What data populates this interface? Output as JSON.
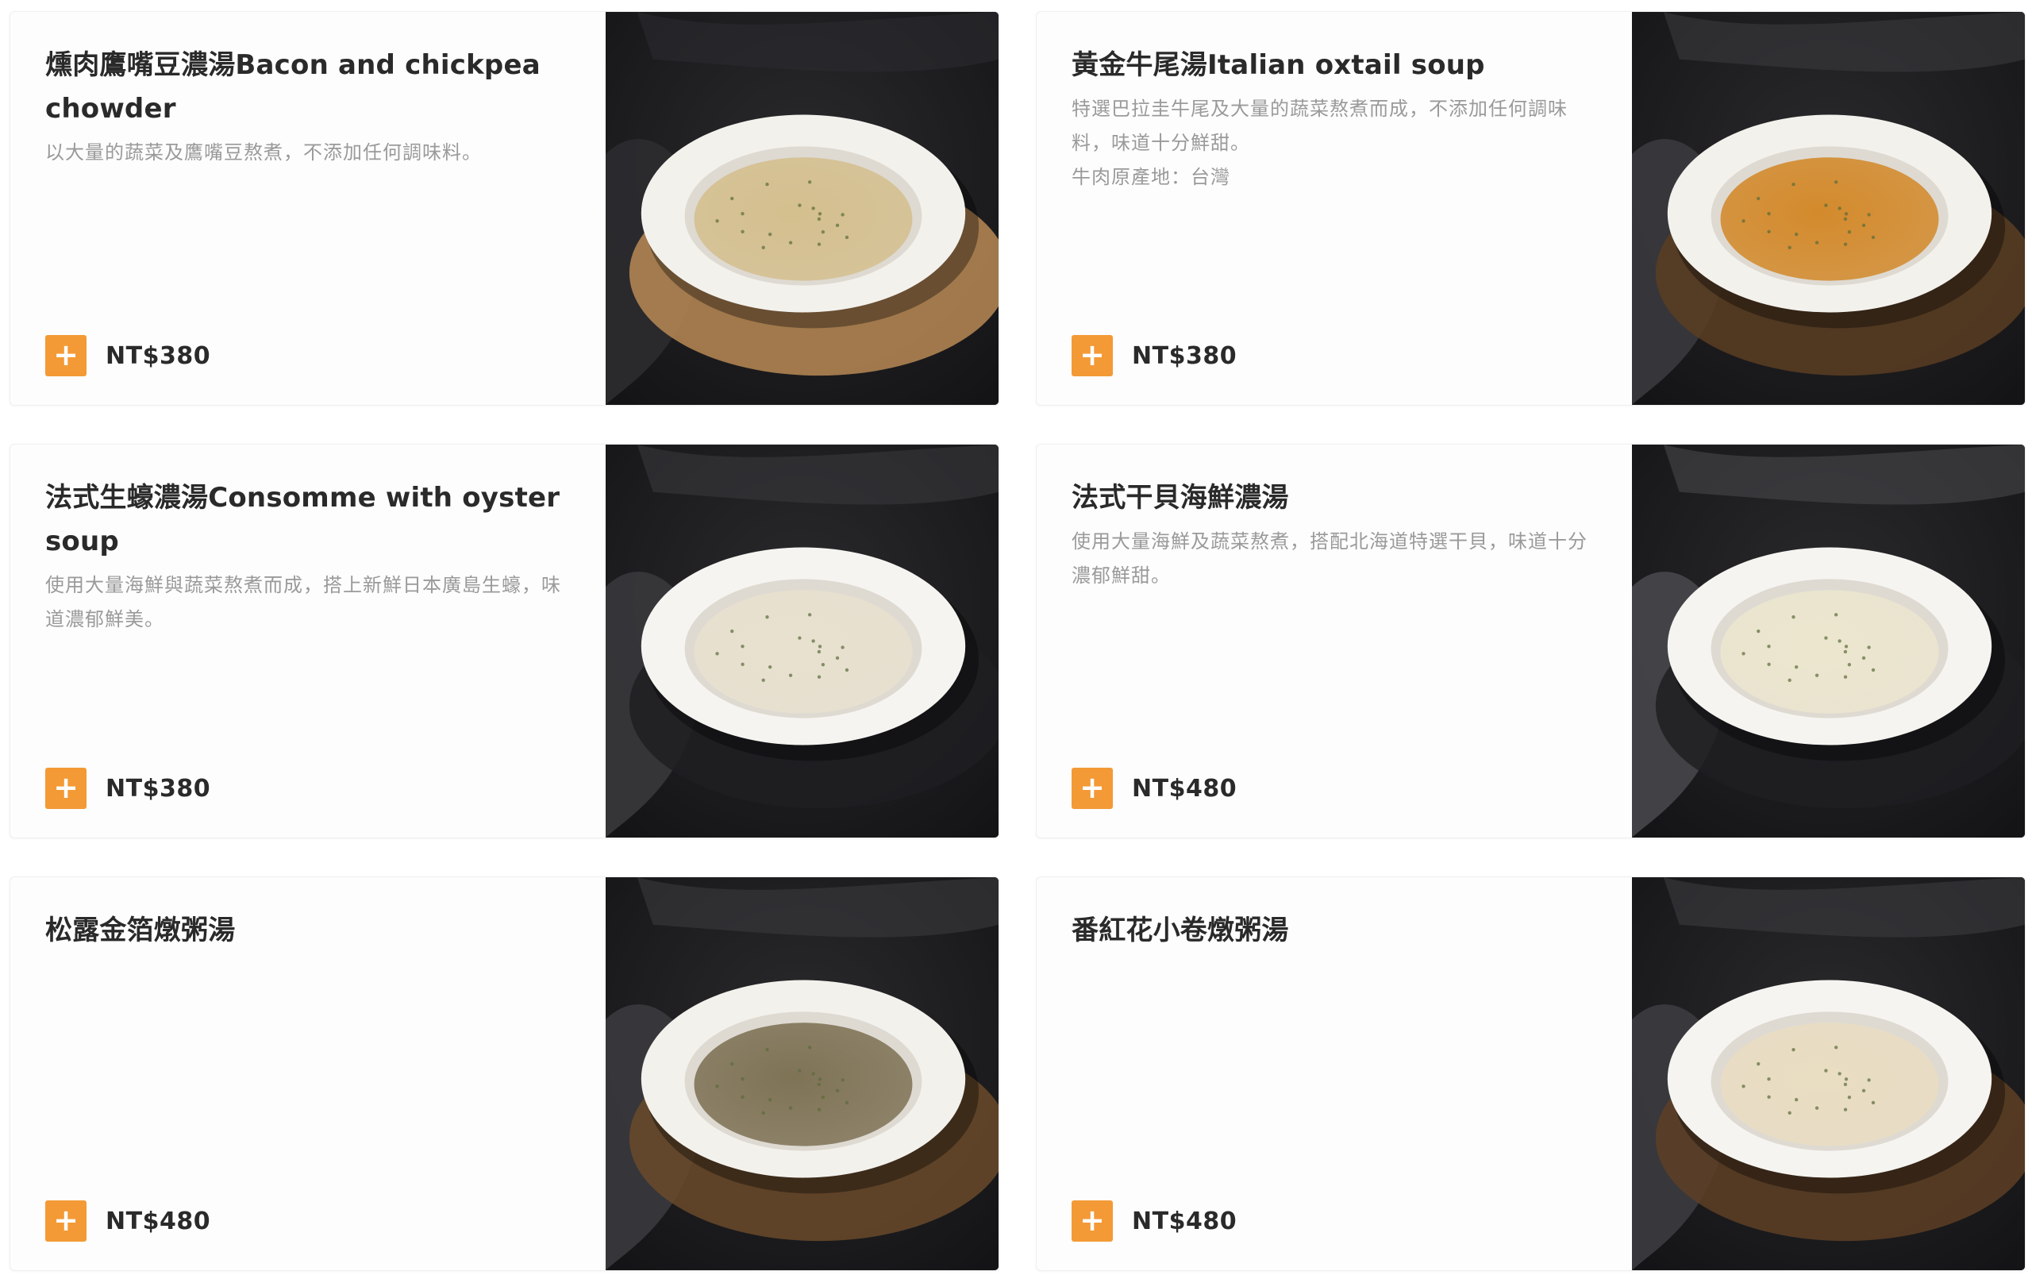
{
  "menu": {
    "items": [
      {
        "name": "燻肉鷹嘴豆濃湯Bacon and chickpea chowder",
        "description": "以大量的蔬菜及鷹嘴豆熬煮，不添加任何調味料。",
        "price": "NT$380",
        "add_icon": "plus-icon",
        "photo": {
          "plate_color": "#f3f1ec",
          "soup_color": "#d4bf8e",
          "board_color": "#b98a55",
          "cloth_color": "#2c2c30"
        }
      },
      {
        "name": "黃金牛尾湯Italian oxtail soup",
        "description": "特選巴拉圭牛尾及大量的蔬菜熬煮而成，不添加任何調味料，味道十分鮮甜。\n牛肉原產地：台灣",
        "price": "NT$380",
        "add_icon": "plus-icon",
        "photo": {
          "plate_color": "#f3f1ec",
          "soup_color": "#d38a2c",
          "board_color": "#5a3d22",
          "cloth_color": "#3a3a3e"
        }
      },
      {
        "name": "法式生蠔濃湯Consomme with oyster soup",
        "description": "使用大量海鮮與蔬菜熬煮而成，搭上新鮮日本廣島生蠔，味道濃郁鮮美。",
        "price": "NT$380",
        "add_icon": "plus-icon",
        "photo": {
          "plate_color": "#f5f4f0",
          "soup_color": "#e8e1cf",
          "board_color": "#1f1f22",
          "cloth_color": "#38383c"
        }
      },
      {
        "name": "法式干貝海鮮濃湯",
        "description": "使用大量海鮮及蔬菜熬煮，搭配北海道特選干貝，味道十分濃郁鮮甜。",
        "price": "NT$480",
        "add_icon": "plus-icon",
        "photo": {
          "plate_color": "#f5f4f0",
          "soup_color": "#ece6cf",
          "board_color": "#1f1f22",
          "cloth_color": "#47474b"
        }
      },
      {
        "name": "松露金箔燉粥湯",
        "description": "",
        "price": "NT$480",
        "add_icon": "plus-icon",
        "photo": {
          "plate_color": "#f3f1ec",
          "soup_color": "#7f7356",
          "board_color": "#6a4a2a",
          "cloth_color": "#3a3a3e"
        }
      },
      {
        "name": "番紅花小卷燉粥湯",
        "description": "",
        "price": "NT$480",
        "add_icon": "plus-icon",
        "photo": {
          "plate_color": "#f5f4f0",
          "soup_color": "#e9ddc2",
          "board_color": "#5e4024",
          "cloth_color": "#3c3c40"
        }
      }
    ]
  }
}
